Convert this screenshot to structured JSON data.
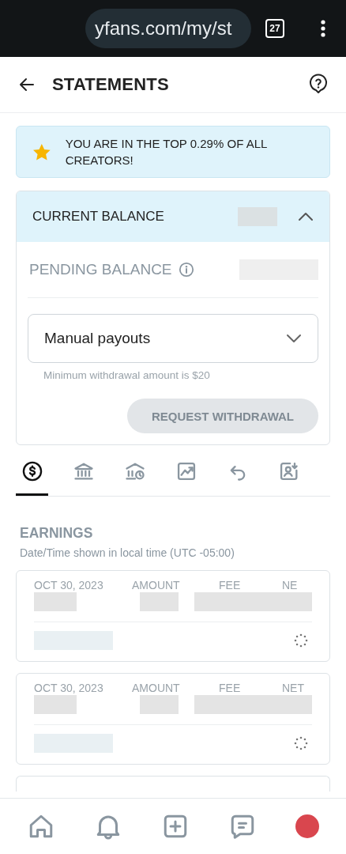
{
  "browser": {
    "url": "yfans.com/my/st",
    "tab_count": "27"
  },
  "header": {
    "title": "STATEMENTS"
  },
  "banner": {
    "text": "YOU ARE IN THE TOP 0.29% OF ALL CREATORS!"
  },
  "balance": {
    "title": "CURRENT BALANCE",
    "expanded": true,
    "pending_label": "PENDING BALANCE",
    "payout": {
      "value": "Manual payouts"
    },
    "hint": "Minimum withdrawal amount is $20",
    "button": {
      "label": "REQUEST WITHDRAWAL",
      "disabled": true
    }
  },
  "tabs": [
    {
      "kind": "dollar",
      "selected": true
    },
    {
      "kind": "bank",
      "selected": false
    },
    {
      "kind": "bank-clock",
      "selected": false
    },
    {
      "kind": "chart",
      "selected": false
    },
    {
      "kind": "undo",
      "selected": false
    },
    {
      "kind": "user-download",
      "selected": false
    }
  ],
  "earnings": {
    "title": "EARNINGS",
    "subtitle": "Date/Time shown in local time (UTC -05:00)",
    "rows": [
      {
        "date": "OCT 30, 2023",
        "amount_label": "AMOUNT",
        "fee_label": "FEE",
        "net_label": "NE"
      },
      {
        "date": "OCT 30, 2023",
        "amount_label": "AMOUNT",
        "fee_label": "FEE",
        "net_label": "NET"
      }
    ]
  },
  "bottom_nav": [
    {
      "kind": "home"
    },
    {
      "kind": "bell"
    },
    {
      "kind": "add"
    },
    {
      "kind": "chat"
    },
    {
      "kind": "avatar"
    }
  ]
}
